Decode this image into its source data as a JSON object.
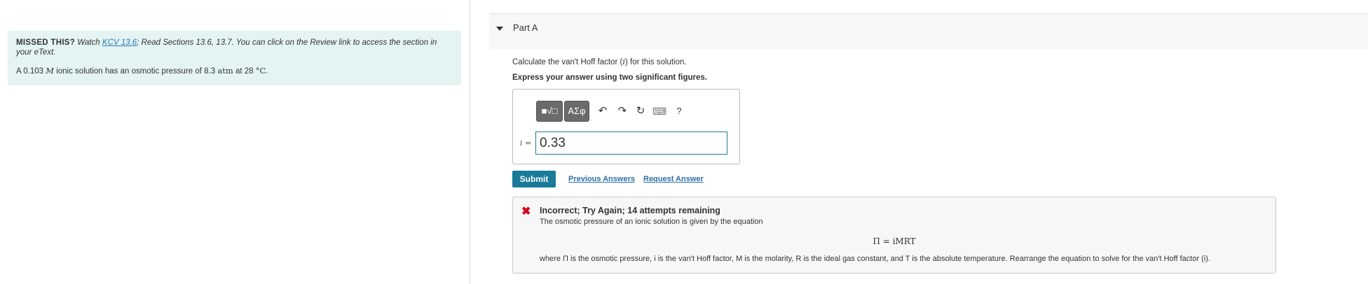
{
  "hint": {
    "missed_label": "MISSED THIS?",
    "watch_prefix": "Watch",
    "watch_link": "KCV 13.6",
    "read_text": "; Read Sections 13.6, 13.7. You can click on the Review link to access the section in your eText."
  },
  "problem": {
    "prefix": "A 0.103",
    "molarity_symbol": "M",
    "middle": "ionic solution has an osmotic pressure of 8.3",
    "pressure_unit": "atm",
    "at": "at 28",
    "temp_unit": "°C."
  },
  "part": {
    "title": "Part A"
  },
  "question": {
    "text_before": "Calculate the van't Hoff factor (",
    "symbol": "i",
    "text_after": ") for this solution.",
    "instruction": "Express your answer using two significant figures."
  },
  "toolbar": {
    "template_label": "■√□",
    "greek_label": "ΑΣφ",
    "undo": "↶",
    "redo": "↷",
    "reset": "↻",
    "keyboard": "⌨",
    "help": "?"
  },
  "answer": {
    "var_label": "i =",
    "value": "0.33"
  },
  "actions": {
    "submit": "Submit",
    "previous_answers": "Previous Answers",
    "request_answer": "Request Answer"
  },
  "feedback": {
    "title": "Incorrect; Try Again; 14 attempts remaining",
    "text": "The osmotic pressure of an ionic solution is given by the equation",
    "equation": "Π = iMRT",
    "rearrange": "where Π is the osmotic pressure, i is the van't Hoff factor, M is the molarity, R is the ideal gas constant, and T is the absolute temperature.  Rearrange the equation to solve for the van't Hoff factor (i)."
  },
  "colors": {
    "hint_bg": "#e4f4f3",
    "submit_bg": "#1a7a9a",
    "link": "#2a6fa8",
    "error": "#d0021b"
  }
}
